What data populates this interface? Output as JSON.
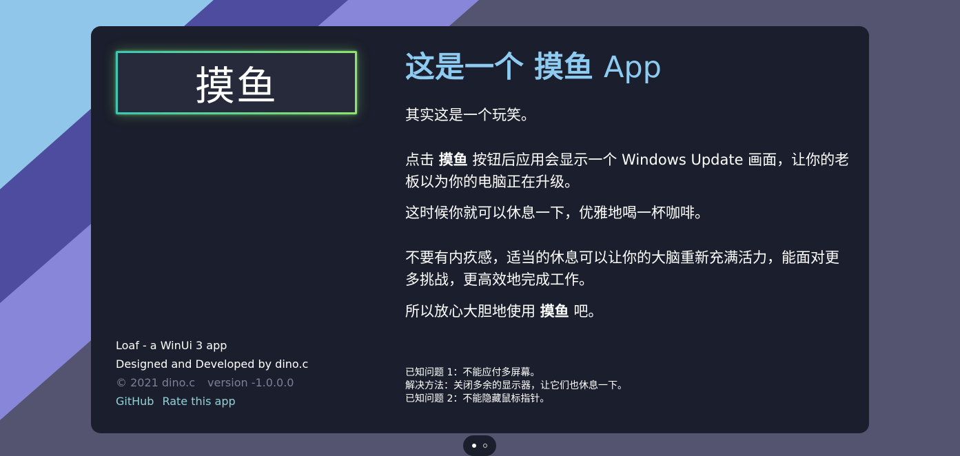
{
  "colors": {
    "background": "#555470",
    "stripe_light_blue": "#8fc6ea",
    "stripe_indigo": "#4e4c9f",
    "stripe_lavender": "#8786d8",
    "card": "#1b1e2c",
    "title": "#8ecbf0",
    "button_border_start": "#3bc6b6",
    "button_border_end": "#8ee36b",
    "link": "#8fd3d6"
  },
  "loaf_button": {
    "label": "摸鱼"
  },
  "footer": {
    "app_name": "Loaf - a WinUi 3 app",
    "credits": "Designed and Developed by dino.c",
    "copyright": "© 2021 dino.c",
    "version": "version -1.0.0.0",
    "links": [
      "GitHub",
      "Rate this app"
    ]
  },
  "main": {
    "title_cn": "这是一个 摸鱼",
    "title_app": "App",
    "intro": "其实这是一个玩笑。",
    "para1_before": "点击 ",
    "para1_bold": "摸鱼",
    "para1_after": " 按钮后应用会显示一个 Windows Update 画面，让你的老板以为你的电脑正在升级。",
    "para2": "这时候你就可以休息一下，优雅地喝一杯咖啡。",
    "para3": "不要有内疚感，适当的休息可以让你的大脑重新充满活力，能面对更多挑战，更高效地完成工作。",
    "para4_before": "所以放心大胆地使用 ",
    "para4_bold": "摸鱼",
    "para4_after": " 吧。"
  },
  "known_issues": [
    "已知问题 1：不能应付多屏幕。",
    "解决方法：关闭多余的显示器，让它们也休息一下。",
    "已知问题 2：不能隐藏鼠标指针。"
  ],
  "pager": {
    "page_count": 2,
    "current_page": 1
  }
}
